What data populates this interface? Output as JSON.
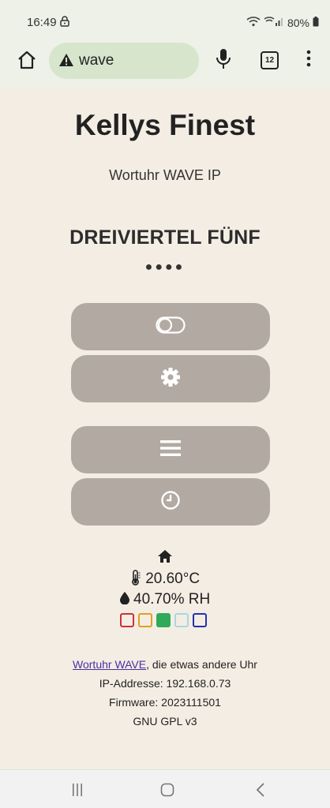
{
  "status_bar": {
    "time": "16:49",
    "battery": "80%"
  },
  "browser": {
    "url": "wave",
    "tab_count": "12"
  },
  "page": {
    "title": "Kellys Finest",
    "subtitle": "Wortuhr WAVE IP",
    "time_words": "DREIVIERTEL FÜNF",
    "minute_dots": "●●●●",
    "buttons": [
      {
        "icon": "toggle-icon"
      },
      {
        "icon": "gear-icon"
      },
      {
        "icon": "menu-icon"
      },
      {
        "icon": "clock-icon"
      }
    ],
    "sensors": {
      "icon": "home-icon",
      "temperature": "20.60°C",
      "humidity": "40.70% RH"
    },
    "color_swatches": [
      {
        "border": "#cc3333",
        "fill": "transparent"
      },
      {
        "border": "#e0a020",
        "fill": "transparent"
      },
      {
        "border": "#2eaa5a",
        "fill": "#2eaa5a"
      },
      {
        "border": "#a8d8e0",
        "fill": "transparent"
      },
      {
        "border": "#2233aa",
        "fill": "transparent"
      }
    ],
    "footer": {
      "link_text": "Wortuhr WAVE",
      "link_suffix": ", die etwas andere Uhr",
      "ip": "IP-Addresse: 192.168.0.73",
      "firmware": "Firmware: 2023111501",
      "license": "GNU GPL v3"
    }
  },
  "colors": {
    "background": "#f4ede4",
    "button": "#b2aaa2",
    "chrome": "#eef1e8",
    "url_pill": "#d7e5cc"
  }
}
